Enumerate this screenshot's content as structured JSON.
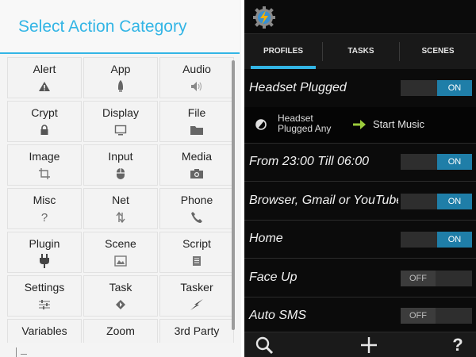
{
  "dialog": {
    "title": "Select Action Category",
    "categories": [
      {
        "label": "Alert",
        "icon": "alert-icon"
      },
      {
        "label": "App",
        "icon": "app-icon"
      },
      {
        "label": "Audio",
        "icon": "audio-icon"
      },
      {
        "label": "Crypt",
        "icon": "lock-icon"
      },
      {
        "label": "Display",
        "icon": "display-icon"
      },
      {
        "label": "File",
        "icon": "folder-icon"
      },
      {
        "label": "Image",
        "icon": "crop-icon"
      },
      {
        "label": "Input",
        "icon": "mouse-icon"
      },
      {
        "label": "Media",
        "icon": "camera-icon"
      },
      {
        "label": "Misc",
        "icon": "question-icon"
      },
      {
        "label": "Net",
        "icon": "transfer-icon"
      },
      {
        "label": "Phone",
        "icon": "phone-icon"
      },
      {
        "label": "Plugin",
        "icon": "plug-icon"
      },
      {
        "label": "Scene",
        "icon": "picture-icon"
      },
      {
        "label": "Script",
        "icon": "document-icon"
      },
      {
        "label": "Settings",
        "icon": "sliders-icon"
      },
      {
        "label": "Task",
        "icon": "diamond-icon"
      },
      {
        "label": "Tasker",
        "icon": "lightning-icon"
      },
      {
        "label": "Variables",
        "icon": ""
      },
      {
        "label": "Zoom",
        "icon": ""
      },
      {
        "label": "3rd Party",
        "icon": ""
      }
    ]
  },
  "tasker": {
    "tabs": [
      "PROFILES",
      "TASKS",
      "SCENES"
    ],
    "active_tab": "PROFILES",
    "context": {
      "state_line1": "Headset",
      "state_line2": "Plugged Any",
      "task": "Start Music"
    },
    "profiles": [
      {
        "name": "Headset Plugged",
        "state": "ON"
      },
      {
        "name": "From 23:00 Till 06:00",
        "state": "ON"
      },
      {
        "name": "Browser, Gmail or YouTube",
        "state": "ON"
      },
      {
        "name": "Home",
        "state": "ON"
      },
      {
        "name": "Face Up",
        "state": "OFF"
      },
      {
        "name": "Auto SMS",
        "state": "OFF"
      }
    ],
    "bottom_actions": [
      "search-icon",
      "add-icon",
      "help-icon"
    ],
    "help_label": "?"
  },
  "colors": {
    "accent": "#33b5e5",
    "toggle_on": "#1f7ea8",
    "dark_bg": "#0b0b0b"
  }
}
